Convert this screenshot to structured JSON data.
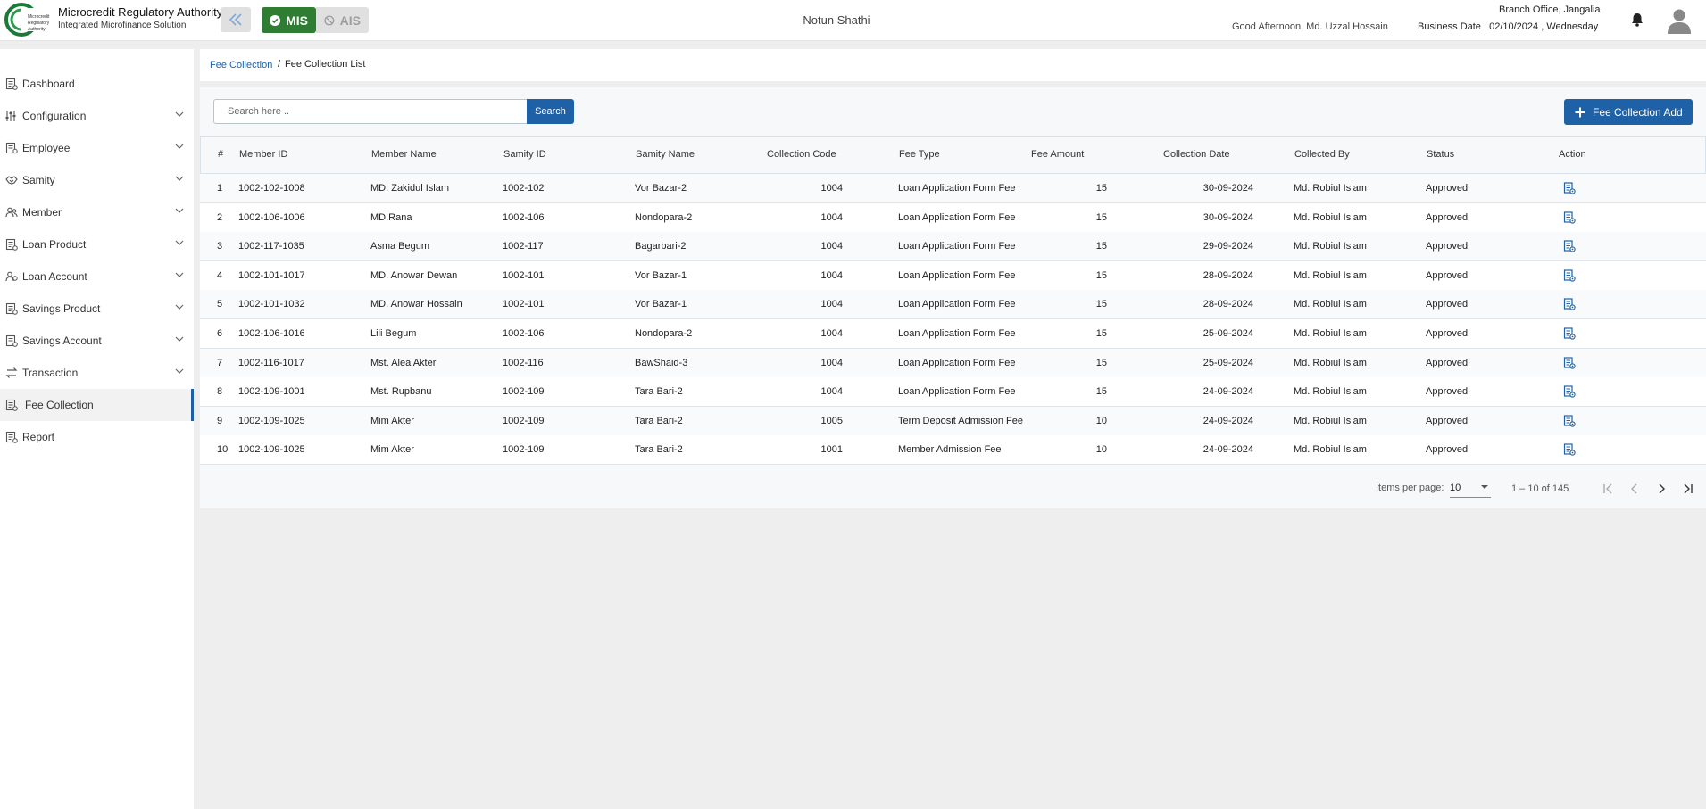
{
  "header": {
    "brand_title": "Microcredit Regulatory Authority",
    "brand_subtitle": "Integrated Microfinance Solution",
    "logo_text": "Microcredit Regulatory Authority",
    "modules": [
      {
        "label": "MIS",
        "active": true
      },
      {
        "label": "AIS",
        "active": false
      }
    ],
    "app_name": "Notun Shathi",
    "greeting": "Good Afternoon, Md. Uzzal Hossain",
    "branch": "Branch Office, Jangalia",
    "business_date": "Business Date : 02/10/2024 , Wednesday",
    "accent_color": "#1e61a6",
    "mis_color": "#2e7d32"
  },
  "sidebar": {
    "items": [
      {
        "label": "Dashboard",
        "icon": "dashboard-icon",
        "expandable": false,
        "active": false
      },
      {
        "label": "Configuration",
        "icon": "sliders-icon",
        "expandable": true,
        "active": false
      },
      {
        "label": "Employee",
        "icon": "employee-icon",
        "expandable": true,
        "active": false
      },
      {
        "label": "Samity",
        "icon": "handshake-icon",
        "expandable": true,
        "active": false
      },
      {
        "label": "Member",
        "icon": "members-icon",
        "expandable": true,
        "active": false
      },
      {
        "label": "Loan Product",
        "icon": "document-icon",
        "expandable": true,
        "active": false
      },
      {
        "label": "Loan Account",
        "icon": "account-icon",
        "expandable": true,
        "active": false
      },
      {
        "label": "Savings Product",
        "icon": "document-icon",
        "expandable": true,
        "active": false
      },
      {
        "label": "Savings Account",
        "icon": "document-icon",
        "expandable": true,
        "active": false
      },
      {
        "label": "Transaction",
        "icon": "transaction-icon",
        "expandable": true,
        "active": false
      },
      {
        "label": "Fee Collection",
        "icon": "document-icon",
        "expandable": false,
        "active": true
      },
      {
        "label": "Report",
        "icon": "report-icon",
        "expandable": false,
        "active": false
      }
    ]
  },
  "breadcrumb": {
    "parent": "Fee Collection",
    "separator": "/",
    "current": "Fee Collection List"
  },
  "toolbar": {
    "search_placeholder": "Search here ..",
    "search_label": "Search",
    "add_label": "Fee Collection Add"
  },
  "table": {
    "columns": [
      "#",
      "Member ID",
      "Member Name",
      "Samity ID",
      "Samity Name",
      "Collection Code",
      "Fee Type",
      "Fee Amount",
      "Collection Date",
      "Collected By",
      "Status",
      "Action"
    ],
    "rows": [
      {
        "n": "1",
        "member_id": "1002-102-1008",
        "member_name": "MD. Zakidul Islam",
        "samity_id": "1002-102",
        "samity_name": "Vor Bazar-2",
        "code": "1004",
        "fee_type": "Loan Application Form Fee",
        "amount": "15",
        "date": "30-09-2024",
        "collected_by": "Md. Robiul Islam",
        "status": "Approved"
      },
      {
        "n": "2",
        "member_id": "1002-106-1006",
        "member_name": "MD.Rana",
        "samity_id": "1002-106",
        "samity_name": "Nondopara-2",
        "code": "1004",
        "fee_type": "Loan Application Form Fee",
        "amount": "15",
        "date": "30-09-2024",
        "collected_by": "Md. Robiul Islam",
        "status": "Approved"
      },
      {
        "n": "3",
        "member_id": "1002-117-1035",
        "member_name": "Asma Begum",
        "samity_id": "1002-117",
        "samity_name": "Bagarbari-2",
        "code": "1004",
        "fee_type": "Loan Application Form Fee",
        "amount": "15",
        "date": "29-09-2024",
        "collected_by": "Md. Robiul Islam",
        "status": "Approved"
      },
      {
        "n": "4",
        "member_id": "1002-101-1017",
        "member_name": "MD. Anowar Dewan",
        "samity_id": "1002-101",
        "samity_name": "Vor Bazar-1",
        "code": "1004",
        "fee_type": "Loan Application Form Fee",
        "amount": "15",
        "date": "28-09-2024",
        "collected_by": "Md. Robiul Islam",
        "status": "Approved"
      },
      {
        "n": "5",
        "member_id": "1002-101-1032",
        "member_name": "MD. Anowar Hossain",
        "samity_id": "1002-101",
        "samity_name": "Vor Bazar-1",
        "code": "1004",
        "fee_type": "Loan Application Form Fee",
        "amount": "15",
        "date": "28-09-2024",
        "collected_by": "Md. Robiul Islam",
        "status": "Approved"
      },
      {
        "n": "6",
        "member_id": "1002-106-1016",
        "member_name": "Lili Begum",
        "samity_id": "1002-106",
        "samity_name": "Nondopara-2",
        "code": "1004",
        "fee_type": "Loan Application Form Fee",
        "amount": "15",
        "date": "25-09-2024",
        "collected_by": "Md. Robiul Islam",
        "status": "Approved"
      },
      {
        "n": "7",
        "member_id": "1002-116-1017",
        "member_name": "Mst. Alea Akter",
        "samity_id": "1002-116",
        "samity_name": "BawShaid-3",
        "code": "1004",
        "fee_type": "Loan Application Form Fee",
        "amount": "15",
        "date": "25-09-2024",
        "collected_by": "Md. Robiul Islam",
        "status": "Approved"
      },
      {
        "n": "8",
        "member_id": "1002-109-1001",
        "member_name": "Mst. Rupbanu",
        "samity_id": "1002-109",
        "samity_name": "Tara Bari-2",
        "code": "1004",
        "fee_type": "Loan Application Form Fee",
        "amount": "15",
        "date": "24-09-2024",
        "collected_by": "Md. Robiul Islam",
        "status": "Approved"
      },
      {
        "n": "9",
        "member_id": "1002-109-1025",
        "member_name": "Mim Akter",
        "samity_id": "1002-109",
        "samity_name": "Tara Bari-2",
        "code": "1005",
        "fee_type": "Term Deposit Admission Fee",
        "amount": "10",
        "date": "24-09-2024",
        "collected_by": "Md. Robiul Islam",
        "status": "Approved"
      },
      {
        "n": "10",
        "member_id": "1002-109-1025",
        "member_name": "Mim Akter",
        "samity_id": "1002-109",
        "samity_name": "Tara Bari-2",
        "code": "1001",
        "fee_type": "Member Admission Fee",
        "amount": "10",
        "date": "24-09-2024",
        "collected_by": "Md. Robiul Islam",
        "status": "Approved"
      }
    ]
  },
  "pagination": {
    "items_per_page_label": "Items per page:",
    "items_per_page": "10",
    "range": "1 – 10 of 145"
  }
}
